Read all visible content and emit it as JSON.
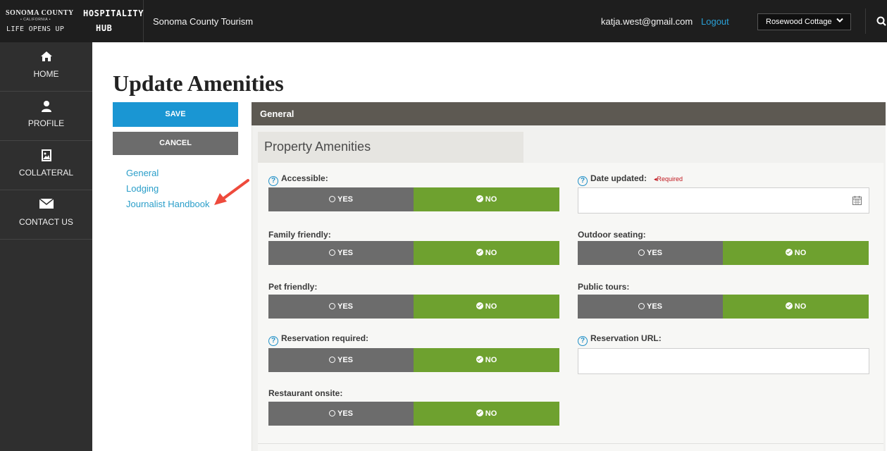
{
  "brand": {
    "line1": "SONOMA COUNTY",
    "line2": "• CALIFORNIA •",
    "line3": "LIFE OPENS UP",
    "hub_line1": "HOSPITALITY",
    "hub_line2": "HUB"
  },
  "header": {
    "site_name": "Sonoma County Tourism",
    "user_email": "katja.west@gmail.com",
    "logout": "Logout",
    "property_selected": "Rosewood Cottage"
  },
  "sidebar": {
    "items": [
      {
        "label": "HOME",
        "icon": "home-icon"
      },
      {
        "label": "PROFILE",
        "icon": "user-icon"
      },
      {
        "label": "COLLATERAL",
        "icon": "image-icon"
      },
      {
        "label": "CONTACT US",
        "icon": "envelope-icon"
      }
    ]
  },
  "page": {
    "title": "Update Amenities",
    "save_label": "SAVE",
    "cancel_label": "CANCEL",
    "anchors": [
      "General",
      "Lodging",
      "Journalist Handbook"
    ]
  },
  "section": {
    "title": "General",
    "tab": "Property Amenities"
  },
  "fields": {
    "accessible": {
      "label": "Accessible:",
      "yes": "YES",
      "no": "NO",
      "selected": "NO"
    },
    "date_updated": {
      "label": "Date updated:",
      "required": "◂Required",
      "value": ""
    },
    "family_friendly": {
      "label": "Family friendly:",
      "yes": "YES",
      "no": "NO",
      "selected": "NO"
    },
    "outdoor_seating": {
      "label": "Outdoor seating:",
      "yes": "YES",
      "no": "NO",
      "selected": "NO"
    },
    "pet_friendly": {
      "label": "Pet friendly:",
      "yes": "YES",
      "no": "NO",
      "selected": "NO"
    },
    "public_tours": {
      "label": "Public tours:",
      "yes": "YES",
      "no": "NO",
      "selected": "NO"
    },
    "reservation_required": {
      "label": "Reservation required:",
      "yes": "YES",
      "no": "NO",
      "selected": "NO"
    },
    "reservation_url": {
      "label": "Reservation URL:",
      "value": ""
    },
    "restaurant_onsite": {
      "label": "Restaurant onsite:",
      "yes": "YES",
      "no": "NO",
      "selected": "NO"
    }
  },
  "colors": {
    "accent_blue": "#1a96d3",
    "selected_green": "#6ea12f",
    "unselected_gray": "#6c6c6c",
    "section_bar": "#5d5952",
    "required_red": "#c0171e"
  }
}
